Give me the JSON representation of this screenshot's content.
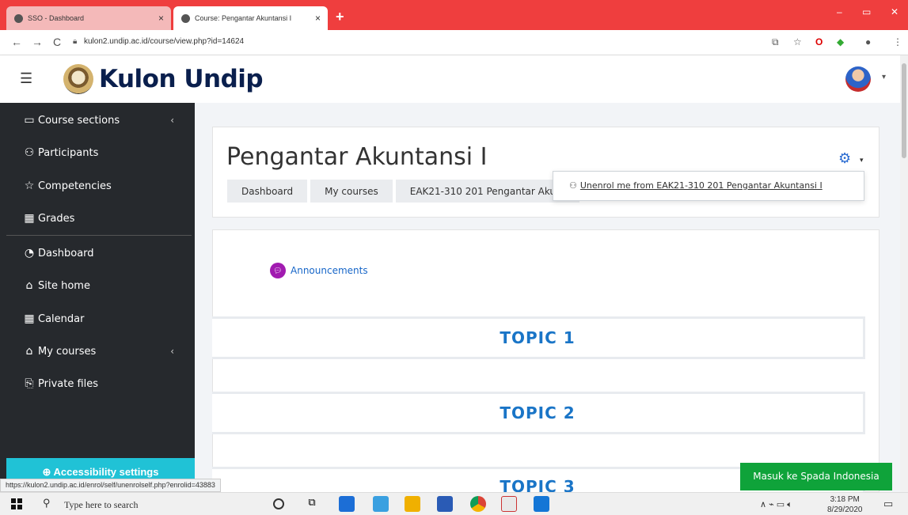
{
  "browser": {
    "tabs": [
      {
        "title": "SSO - Dashboard",
        "close": "×"
      },
      {
        "title": "Course: Pengantar Akuntansi I",
        "close": "×"
      }
    ],
    "new_tab": "+",
    "window_controls": {
      "minimize": "–",
      "maximize": "▭",
      "close": "✕"
    },
    "url": "kulon2.undip.ac.id/course/view.php?id=14624",
    "back": "←",
    "forward": "→",
    "reload": "C"
  },
  "header": {
    "brand": "Kulon Undip",
    "menu_icon": "☰",
    "avatar_caret": "▾"
  },
  "sidebar": {
    "items": [
      {
        "label": "Course sections",
        "icon": "▭",
        "caret": "‹"
      },
      {
        "label": "Participants",
        "icon": "⚇"
      },
      {
        "label": "Competencies",
        "icon": "☆"
      },
      {
        "label": "Grades",
        "icon": "▦"
      },
      {
        "label": "Dashboard",
        "icon": "◔"
      },
      {
        "label": "Site home",
        "icon": "⌂"
      },
      {
        "label": "Calendar",
        "icon": "▦"
      },
      {
        "label": "My courses",
        "icon": "⌂",
        "caret": "‹"
      },
      {
        "label": "Private files",
        "icon": "⎘"
      }
    ],
    "accessibility": "Accessibility settings"
  },
  "course": {
    "title": "Pengantar Akuntansi I",
    "breadcrumbs": [
      "Dashboard",
      "My courses",
      "EAK21-310 201 Pengantar Akunt"
    ],
    "settings_menu": {
      "item": "Unenrol me from EAK21-310 201 Pengantar Akuntansi I"
    },
    "announcements": "Announcements",
    "topics": [
      "TOPIC 1",
      "TOPIC 2",
      "TOPIC 3"
    ]
  },
  "status_url": "https://kulon2.undip.ac.id/enrol/self/unenrolself.php?enrolid=43883",
  "spada_button": "Masuk ke Spada Indonesia",
  "taskbar": {
    "search_placeholder": "Type here to search",
    "time": "3:18 PM",
    "date": "8/29/2020"
  },
  "colors": {
    "tabbar": "#ef3e3e",
    "sidebar": "#26292d",
    "accent": "#1a75c7",
    "spada": "#0fa33a",
    "accessibility": "#20c2d6"
  }
}
